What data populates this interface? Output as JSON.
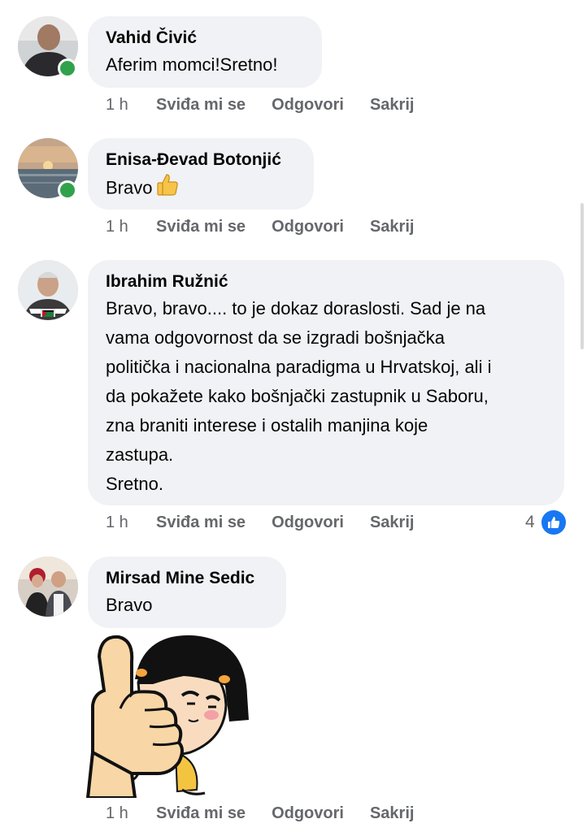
{
  "comments": [
    {
      "author": "Vahid Čivić",
      "text": "Aferim momci!Sretno!",
      "time": "1 h",
      "actions": [
        "Sviđa mi se",
        "Odgovori",
        "Sakrij"
      ]
    },
    {
      "author": "Enisa-Đevad Botonjić",
      "text": "Bravo",
      "time": "1 h",
      "actions": [
        "Sviđa mi se",
        "Odgovori",
        "Sakrij"
      ]
    },
    {
      "author": "Ibrahim Ružnić",
      "text": "Bravo, bravo.... to je dokaz doraslosti. Sad je na\nvama odgovornost da se izgradi bošnjačka\npolitička i nacionalna paradigma u Hrvatskoj, ali i\nda pokažete kako bošnjački zastupnik u Saboru,\nzna braniti interese i ostalih manjina koje\nzastupa.\nSretno.",
      "time": "1 h",
      "actions": [
        "Sviđa mi se",
        "Odgovori",
        "Sakrij"
      ],
      "reaction_count": "4"
    },
    {
      "author": "Mirsad Mine Sedic",
      "text": "Bravo",
      "time": "1 h",
      "actions": [
        "Sviđa mi se",
        "Odgovori",
        "Sakrij"
      ]
    }
  ],
  "colors": {
    "bubble": "#f0f2f5",
    "meta_text": "#65676b",
    "online": "#31a24c",
    "like_blue": "#1877f2"
  },
  "icons": {
    "online_status": "green-dot",
    "thumbs_up_emoji": "thumbs-up-emoji",
    "like_reaction": "like-thumb-icon",
    "sticker": "thumbs-up-girl-sticker"
  }
}
